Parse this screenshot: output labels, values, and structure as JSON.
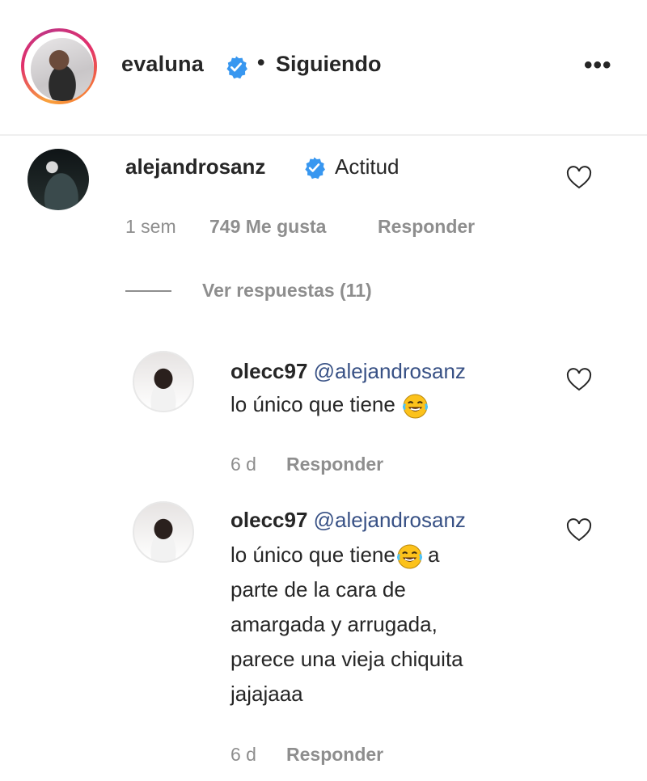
{
  "header": {
    "username": "evaluna",
    "separator": "•",
    "follow_status": "Siguiendo",
    "more_label": "•••"
  },
  "comments": [
    {
      "username": "alejandrosanz",
      "verified": true,
      "text": "Actitud",
      "time": "1 sem",
      "likes": "749 Me gusta",
      "reply_label": "Responder",
      "view_replies": "Ver respuestas (11)"
    }
  ],
  "replies": [
    {
      "username": "olecc97",
      "mention": "@alejandrosanz",
      "lines": [
        "lo único que tiene"
      ],
      "emoji": "face-with-tears-of-joy",
      "time": "6 d",
      "reply_label": "Responder"
    },
    {
      "username": "olecc97",
      "mention": "@alejandrosanz",
      "first_line_before_emoji": "lo único que tiene",
      "first_line_after_emoji": " a",
      "lines": [
        "parte de la cara de",
        "amargada y arrugada,",
        "parece una vieja chiquita",
        "jajajaaa"
      ],
      "emoji": "face-with-tears-of-joy",
      "time": "6 d",
      "reply_label": "Responder"
    }
  ],
  "colors": {
    "verified_blue": "#3897f0",
    "mention_blue": "#385185",
    "secondary_text": "#8e8e8e"
  }
}
